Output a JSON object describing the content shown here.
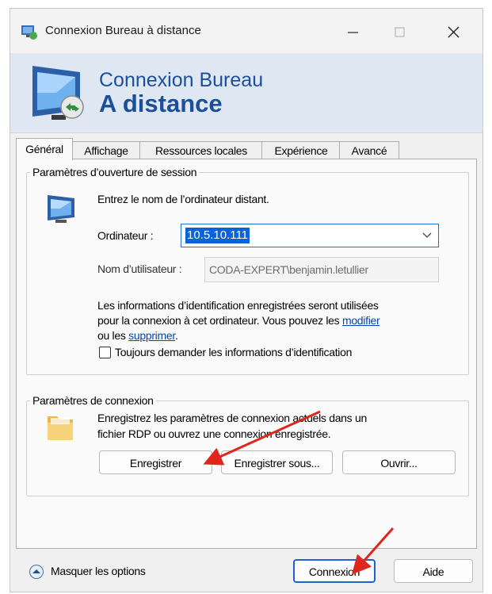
{
  "window": {
    "title": "Connexion Bureau à distance",
    "controls": [
      "minimize",
      "maximize",
      "close"
    ]
  },
  "banner": {
    "line1": "Connexion Bureau",
    "line2": "A distance"
  },
  "tabs": [
    {
      "label": "Général",
      "active": true
    },
    {
      "label": "Affichage",
      "active": false
    },
    {
      "label": "Ressources locales",
      "active": false
    },
    {
      "label": "Expérience",
      "active": false
    },
    {
      "label": "Avancé",
      "active": false
    }
  ],
  "session": {
    "legend": "Paramètres d’ouverture de session",
    "prompt": "Entrez le nom de l’ordinateur distant.",
    "computer_label": "Ordinateur :",
    "computer_value": "10.5.10.111",
    "user_label": "Nom d’utilisateur :",
    "user_value": "CODA-EXPERT\\benjamin.letullier",
    "info_line1": "Les informations d’identification enregistrées seront utilisées",
    "info_line2_prefix": "pour la connexion à cet ordinateur. Vous pouvez les ",
    "link_modify": "modifier",
    "info_line3_prefix": "ou les ",
    "link_delete": "supprimer",
    "info_line3_suffix": ".",
    "always_ask_label": "Toujours demander les informations d’identification",
    "always_ask_checked": false
  },
  "connection": {
    "legend": "Paramètres de connexion",
    "text_line1": "Enregistrez les paramètres de connexion actuels dans un",
    "text_line2": "fichier RDP ou ouvrez une connexion enregistrée.",
    "save_label": "Enregistrer",
    "save_as_label": "Enregistrer sous...",
    "open_label": "Ouvrir..."
  },
  "footer": {
    "hide_options_label": "Masquer les options",
    "connect_label": "Connexion",
    "help_label": "Aide"
  },
  "colors": {
    "accent": "#1f6fd1",
    "banner_text": "#1b4f9c",
    "annotation_arrow": "#e0261c",
    "link": "#0645ad"
  },
  "icons": [
    "rdp-app-icon",
    "monitor-icon",
    "folder-icon",
    "chevron-down-icon",
    "chevron-up-circle-icon",
    "minimize-icon",
    "maximize-icon",
    "close-icon"
  ]
}
